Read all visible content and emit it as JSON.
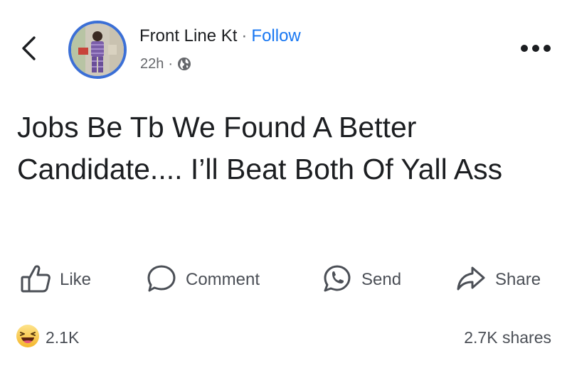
{
  "post": {
    "author": "Front Line Kt",
    "separator": "·",
    "follow_label": "Follow",
    "time": "22h",
    "visibility_icon": "globe-icon",
    "text": "Jobs Be Tb We Found A Better Candidate.... I’ll Beat Both Of Yall Ass"
  },
  "actions": {
    "like": "Like",
    "comment": "Comment",
    "send": "Send",
    "share": "Share"
  },
  "stats": {
    "reaction_icon": "laughing-emoji-icon",
    "reactions": "2.1K",
    "shares": "2.7K shares"
  },
  "colors": {
    "accent": "#1877f2",
    "avatar_ring": "#3b6fd6",
    "text": "#1c1e21",
    "muted": "#65676b"
  }
}
